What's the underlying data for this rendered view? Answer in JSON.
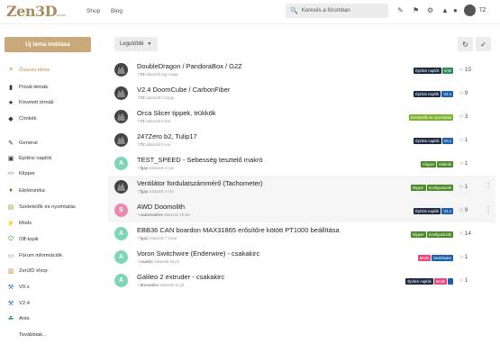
{
  "header": {
    "logo": "Zen3D",
    "logo_sub": "forum",
    "nav": [
      "Shop",
      "Blog"
    ],
    "search_placeholder": "Keresés a fórumban",
    "user": "TZ"
  },
  "sidebar": {
    "new_topic": "Új téma indítása",
    "items": [
      {
        "label": "Összes téma",
        "icon": "stack-icon",
        "color": "#c0894a"
      },
      {
        "label": "Privát témák",
        "icon": "book-icon",
        "color": "#333"
      },
      {
        "label": "Követett témák",
        "icon": "star-icon",
        "color": "#333"
      },
      {
        "label": "Címkék",
        "icon": "tag-icon",
        "color": "#333"
      },
      {
        "label": "General",
        "icon": "pen-icon",
        "color": "#333"
      },
      {
        "label": "Építési naplók",
        "icon": "camera-icon",
        "color": "#333"
      },
      {
        "label": "Klipper",
        "icon": "code-icon",
        "color": "#4a8a2a"
      },
      {
        "label": "Elektronika",
        "icon": "chip-icon",
        "color": "#c0392b"
      },
      {
        "label": "Szeletelők és nyomtatás",
        "icon": "printer-icon",
        "color": "#7bb32e"
      },
      {
        "label": "Mods",
        "icon": "bolt-icon",
        "color": "#e8457a"
      },
      {
        "label": "Off-topik",
        "icon": "power-icon",
        "color": "#3a8a3a"
      },
      {
        "label": "Fórum információk",
        "icon": "chat-icon",
        "color": "#777"
      },
      {
        "label": "Zen3D shop",
        "icon": "cart-icon",
        "color": "#c0894a"
      },
      {
        "label": "V0.x",
        "icon": "wrench-icon",
        "color": "#1f5ea8"
      },
      {
        "label": "V2.4",
        "icon": "wrench-icon",
        "color": "#1f5ea8"
      },
      {
        "label": "Ants",
        "icon": "leaf-icon",
        "color": "#2e8b57"
      },
      {
        "label": "Továbbiak...",
        "icon": "",
        "color": "#333"
      }
    ]
  },
  "toolbar": {
    "filter": "Legutóbbi",
    "refresh_icon": "refresh-icon",
    "check_icon": "check-icon"
  },
  "topics": [
    {
      "title": "DoubleDragon / PandoraBox / G2Z",
      "user": "TZ",
      "meta": "válaszolt egy napja",
      "avatar": "dragon",
      "tags": [
        {
          "t": "Építési naplók",
          "c": "#1e2a44"
        },
        {
          "t": "Ants",
          "c": "#2e8b57"
        }
      ],
      "replies": "15"
    },
    {
      "title": "V2.4 DoomCube / CarbonFiber",
      "user": "TZ",
      "meta": "válaszolt 8 napja",
      "avatar": "dragon",
      "tags": [
        {
          "t": "Építési naplók",
          "c": "#1e2a44"
        },
        {
          "t": "V2.4",
          "c": "#1f5ea8"
        }
      ],
      "replies": "9"
    },
    {
      "title": "Orca Slicer tippek, trükkök",
      "user": "TZ",
      "meta": "válaszolt 9 nov",
      "avatar": "dragon",
      "tags": [
        {
          "t": "Szeletelők és nyomtatás",
          "c": "#7bb32e"
        }
      ],
      "replies": "3"
    },
    {
      "title": "247Zero b2, Tulip17",
      "user": "TZ",
      "meta": "válaszolt 9 nov",
      "avatar": "dragon",
      "tags": [
        {
          "t": "Építési naplók",
          "c": "#1e2a44"
        },
        {
          "t": "V0.x",
          "c": "#1f5ea8"
        }
      ],
      "replies": "1"
    },
    {
      "title": "TEST_SPEED - Sebesség tesztelő makró",
      "user": "fgzp",
      "meta": "válaszolt 4 nov",
      "avatar": "A",
      "avatarColor": "#7fd6b5",
      "tags": [
        {
          "t": "Klipper",
          "c": "#4a8a2a"
        },
        {
          "t": "Makrók",
          "c": "#4a8a2a"
        }
      ],
      "replies": "1"
    },
    {
      "title": "Ventilátor fordulatszámmérő (Tachometer)",
      "user": "fgzp",
      "meta": "válaszolt 4 nov",
      "avatar": "dragon",
      "tags": [
        {
          "t": "Klipper",
          "c": "#4a8a2a"
        },
        {
          "t": "Konfigurációk",
          "c": "#4a8a2a"
        }
      ],
      "replies": "1",
      "alt": true
    },
    {
      "title": "AWD Doomolith",
      "user": "szabolsakire",
      "meta": "válaszolt 18 okt",
      "avatar": "S",
      "avatarColor": "#e88ab0",
      "tags": [
        {
          "t": "Építési naplók",
          "c": "#1e2a44"
        },
        {
          "t": "V2.4",
          "c": "#1f5ea8"
        }
      ],
      "replies": "9",
      "alt": true
    },
    {
      "title": "EBB36 CAN boardon MAX31865 erősítőre kötött PT1000 beállítása",
      "user": "fgzp",
      "meta": "válaszolt 7 szept",
      "avatar": "A",
      "avatarColor": "#7fd6b5",
      "tags": [
        {
          "t": "Klipper",
          "c": "#4a8a2a"
        },
        {
          "t": "Konfigurációk",
          "c": "#4a8a2a"
        }
      ],
      "replies": "14"
    },
    {
      "title": "Voron Switchwire (Enderwire) - csakakirc",
      "user": "csakirc",
      "meta": "válaszolt 16 júl",
      "avatar": "A",
      "avatarColor": "#7fd6b5",
      "tags": [
        {
          "t": "Mods",
          "c": "#e8457a"
        },
        {
          "t": "Switchwire",
          "c": "#1f5ea8"
        }
      ],
      "replies": "1"
    },
    {
      "title": "Galileo 2 extruder - csakakirc",
      "user": "dronoidco",
      "meta": "válaszolt 11 júl",
      "avatar": "A",
      "avatarColor": "#7fd6b5",
      "tags": [
        {
          "t": "Építési naplók",
          "c": "#1e2a44"
        },
        {
          "t": "Mods",
          "c": "#e8457a"
        },
        {
          "t": "",
          "c": "#1f5ea8"
        }
      ],
      "replies": "1"
    }
  ]
}
